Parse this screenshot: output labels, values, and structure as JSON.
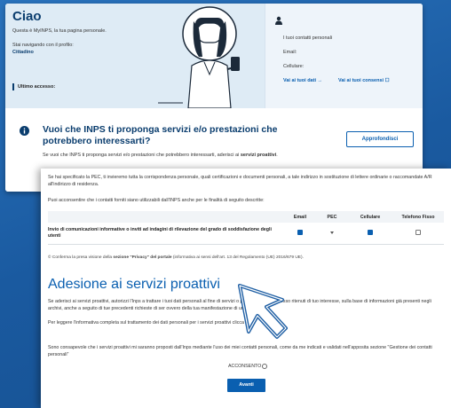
{
  "colors": {
    "background": "#1b5fa8",
    "primary": "#0a5fb0",
    "heading": "#0a3d6e",
    "profile_band": "#deebf5"
  },
  "home": {
    "greeting": "Ciao",
    "welcome": "Questa è MyINPS, la tua pagina personale.",
    "navigating_as": "Stai navigando con il profilo:",
    "profile": "Cittadino",
    "last_access_label": "Ultimo accesso:",
    "contacts": {
      "icon": "person-icon",
      "title": "I tuoi contatti personali",
      "email_label": "Email:",
      "phone_label": "Cellulare:",
      "link_data": "Vai ai tuoi dati →",
      "link_consents": "Vai ai tuoi consensi ☐"
    },
    "banner": {
      "icon": "info-icon",
      "title": "Vuoi che INPS ti proponga servizi e/o prestazioni che potrebbero interessarti?",
      "text_before": "Se vuoi che INPS ti proponga servizi e/o prestazioni che potrebbero interessarti, aderisci ai",
      "text_bold": "servizi proattivi",
      "button": "Approfondisci"
    }
  },
  "form": {
    "pec_text": "Se hai specificato la PEC, ti invieremo tutta la corrispondenza personale, quali certificazioni e documenti personali, a tale indirizzo in sostituzione di lettere ordinarie o raccomandate A/R all'indirizzo di residenza.",
    "consent_text": "Puoi acconsentire che i contatti forniti siano utilizzabili dall'INPS anche per le finalità di seguito descritte:",
    "table": {
      "headers": [
        "",
        "Email",
        "PEC",
        "Cellulare",
        "Telefono Fisso"
      ],
      "row_label": "Invio di comunicazioni informative o inviti ad indagini di rilevazione del grado di soddisfazione degli utenti",
      "values": [
        "checked",
        "dropdown",
        "checked",
        "unchecked"
      ]
    },
    "privacy_before": "© Conferma la presa visione della",
    "privacy_bold": "sezione \"Privacy\" del portale",
    "privacy_after": "(informativa ai sensi dell'art. 13 del Regolamento (UE) 2016/679 UE).",
    "section_title": "Adesione ai servizi proattivi",
    "p1": "Se aderisci ai servizi proattivi, autorizzi l'Inps a trattare i tuoi dati personali al fine di servizi o prestazioni, dallo stesso ritenuti di tuo interesse, sulla base di informazioni già presenti negli archivi, anche a seguito di tue precedenti richieste di ser ovvero della tua manifestazione di un bisogno.",
    "p2_before": "Per leggere l'informativa completa sul trattamento dei dati personali per i servizi proattivi clicca",
    "p2_link": "qui",
    "p3": "Sono consapevole che i servizi proattivi mi saranno proposti dall'Inps mediante l'uso dei miei contatti personali, come da me indicati e validati nell'apposita sezione \"Gestione dei contatti personali\"",
    "acconsento": "ACCONSENTO",
    "avanti": "Avanti"
  },
  "cursor_icon": "pointer-arrow-icon"
}
